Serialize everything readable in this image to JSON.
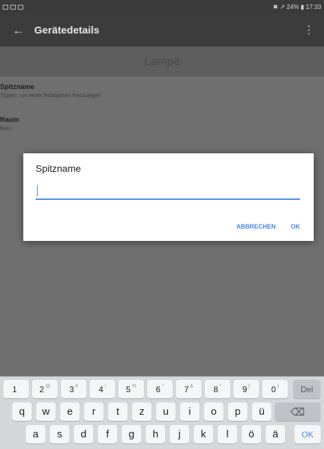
{
  "status_bar": {
    "right_text": "✖ ↗ 24% ▮ 17:33"
  },
  "app_bar": {
    "title": "Gerätedetails",
    "back_icon": "←",
    "more_icon": "⋮"
  },
  "device": {
    "name": "Lampe"
  },
  "settings": [
    {
      "title": "Spitzname",
      "subtitle": "Tippen, um einen Nicknamen festzulegen"
    },
    {
      "title": "Raum",
      "subtitle": "Büro"
    }
  ],
  "dialog": {
    "title": "Spitzname",
    "input_value": "",
    "cancel_label": "ABBRECHEN",
    "ok_label": "OK",
    "accent_color": "#4a86e8"
  },
  "keyboard": {
    "row1": [
      {
        "k": "1",
        "s": "`"
      },
      {
        "k": "2",
        "s": "@"
      },
      {
        "k": "3",
        "s": "#"
      },
      {
        "k": "4",
        "s": "/"
      },
      {
        "k": "5",
        "s": "%"
      },
      {
        "k": "6",
        "s": "^"
      },
      {
        "k": "7",
        "s": "&"
      },
      {
        "k": "8",
        "s": "*"
      },
      {
        "k": "9",
        "s": "("
      },
      {
        "k": "0",
        "s": ")"
      }
    ],
    "del_label": "Del",
    "row2": [
      "q",
      "w",
      "e",
      "r",
      "t",
      "z",
      "u",
      "i",
      "o",
      "p",
      "ü"
    ],
    "backspace_icon": "⌫",
    "row3": [
      "a",
      "s",
      "d",
      "f",
      "g",
      "h",
      "j",
      "k",
      "l",
      "ö",
      "ä"
    ],
    "ok_label": "OK"
  }
}
